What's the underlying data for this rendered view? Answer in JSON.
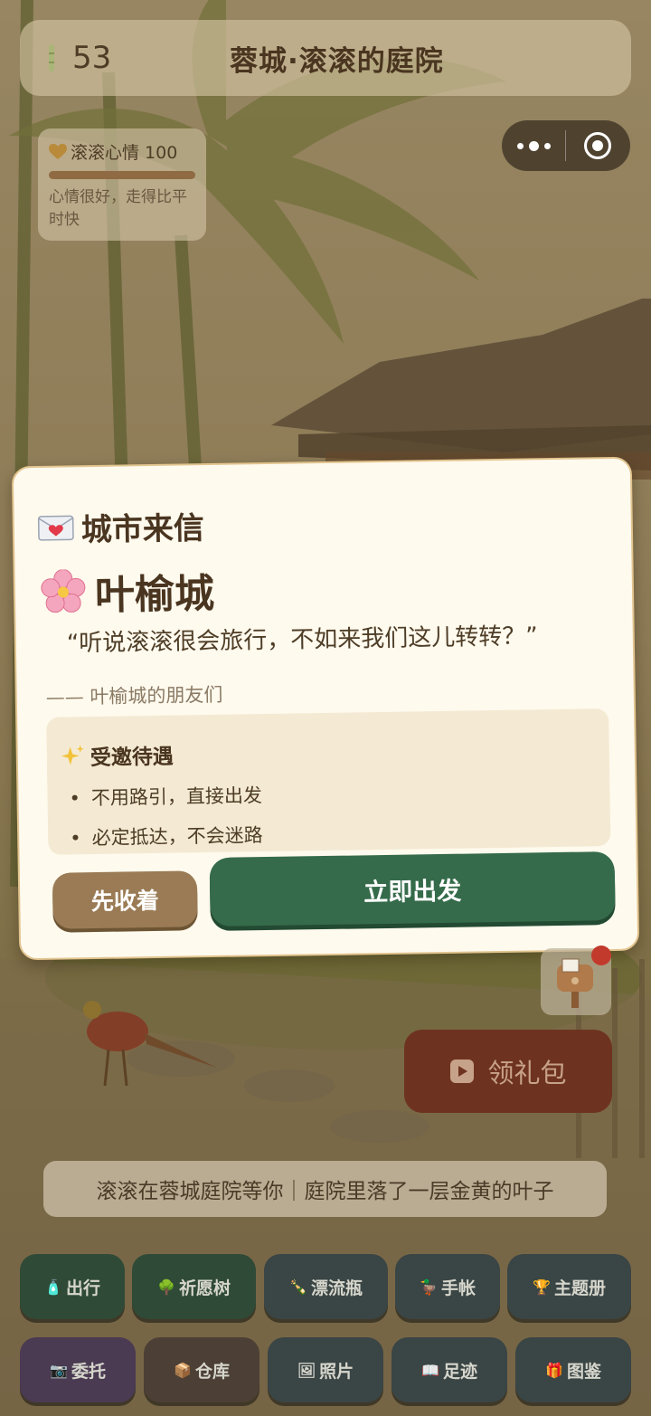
{
  "header": {
    "bamboo_count": "53",
    "title": "蓉城·滚滚的庭院",
    "bamboo_icon": "bamboo-icon"
  },
  "capsule": {
    "more_icon": "more-dots-icon",
    "close_icon": "target-close-icon"
  },
  "mood": {
    "label": "滚滚心情 100",
    "level": 1.0,
    "description": "心情很好，走得比平时快"
  },
  "letter": {
    "heading": "城市来信",
    "city": "叶榆城",
    "quote": "“听说滚滚很会旅行，不如来我们这儿转转？”",
    "signature": "—— 叶榆城的朋友们",
    "perks_title": "受邀待遇",
    "perks": [
      "不用路引，直接出发",
      "必定抵达，不会迷路"
    ],
    "later_button": "先收着",
    "go_button": "立即出发"
  },
  "gift": {
    "label": "领礼包"
  },
  "status_text": "滚滚在蓉城庭院等你｜庭院里落了一层金黄的叶子",
  "nav": {
    "row1": [
      {
        "icon": "🧴",
        "label": "出行"
      },
      {
        "icon": "🌳",
        "label": "祈愿树"
      },
      {
        "icon": "🍾",
        "label": "漂流瓶"
      },
      {
        "icon": "🦆",
        "label": "手帐"
      },
      {
        "icon": "🏆",
        "label": "主题册"
      }
    ],
    "row2": [
      {
        "icon": "📷",
        "label": "委托"
      },
      {
        "icon": "📦",
        "label": "仓库"
      },
      {
        "icon": "🖼",
        "label": "照片"
      },
      {
        "icon": "📖",
        "label": "足迹"
      },
      {
        "icon": "🎁",
        "label": "图鉴"
      }
    ]
  },
  "colors": {
    "go_button": "#356b4a",
    "later_button": "#9a7b55",
    "gift_button": "#6e3320",
    "modal_bg": "#fffaee"
  }
}
